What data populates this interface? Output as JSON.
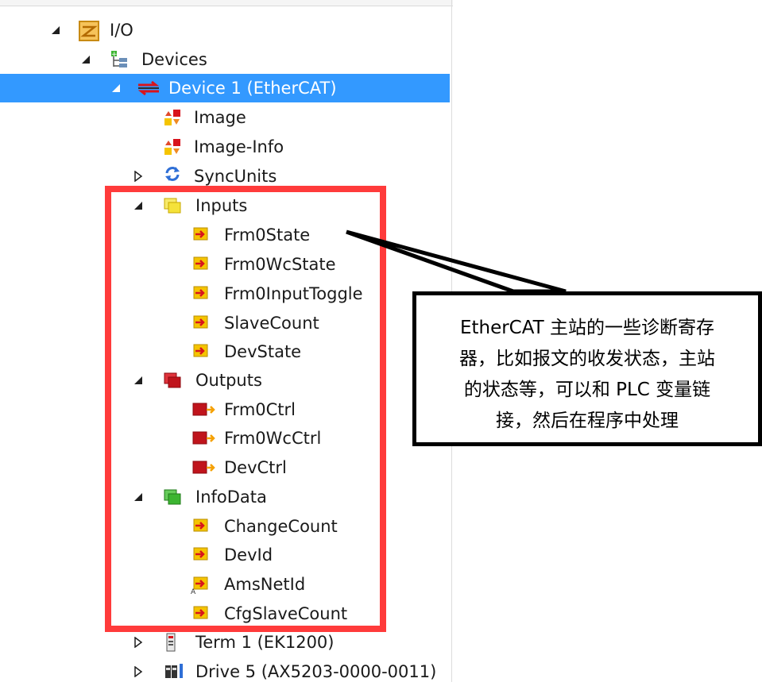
{
  "tree": {
    "io_label": "I/O",
    "devices_label": "Devices",
    "device1_label": "Device 1 (EtherCAT)",
    "image_label": "Image",
    "image_info_label": "Image-Info",
    "syncunits_label": "SyncUnits",
    "inputs_label": "Inputs",
    "inputs_items": [
      "Frm0State",
      "Frm0WcState",
      "Frm0InputToggle",
      "SlaveCount",
      "DevState"
    ],
    "outputs_label": "Outputs",
    "outputs_items": [
      "Frm0Ctrl",
      "Frm0WcCtrl",
      "DevCtrl"
    ],
    "infodata_label": "InfoData",
    "infodata_items": [
      "ChangeCount",
      "DevId",
      "AmsNetId",
      "CfgSlaveCount"
    ],
    "term1_label": "Term 1 (EK1200)",
    "drive5_label": "Drive 5 (AX5203-0000-0011)"
  },
  "callout": {
    "lines": [
      "EtherCAT 主站的一些诊断寄存",
      "器，比如报文的收发状态，主站",
      "的状态等，可以和 PLC 变量链",
      "接，然后在程序中处理"
    ]
  },
  "colors": {
    "selection": "#3399ff",
    "highlight_box": "#ff3b3b",
    "inputs_folder": "#f5e23a",
    "outputs_folder": "#c0141c",
    "infodata_folder": "#3cb531",
    "io_icon": "#e2a11f"
  }
}
